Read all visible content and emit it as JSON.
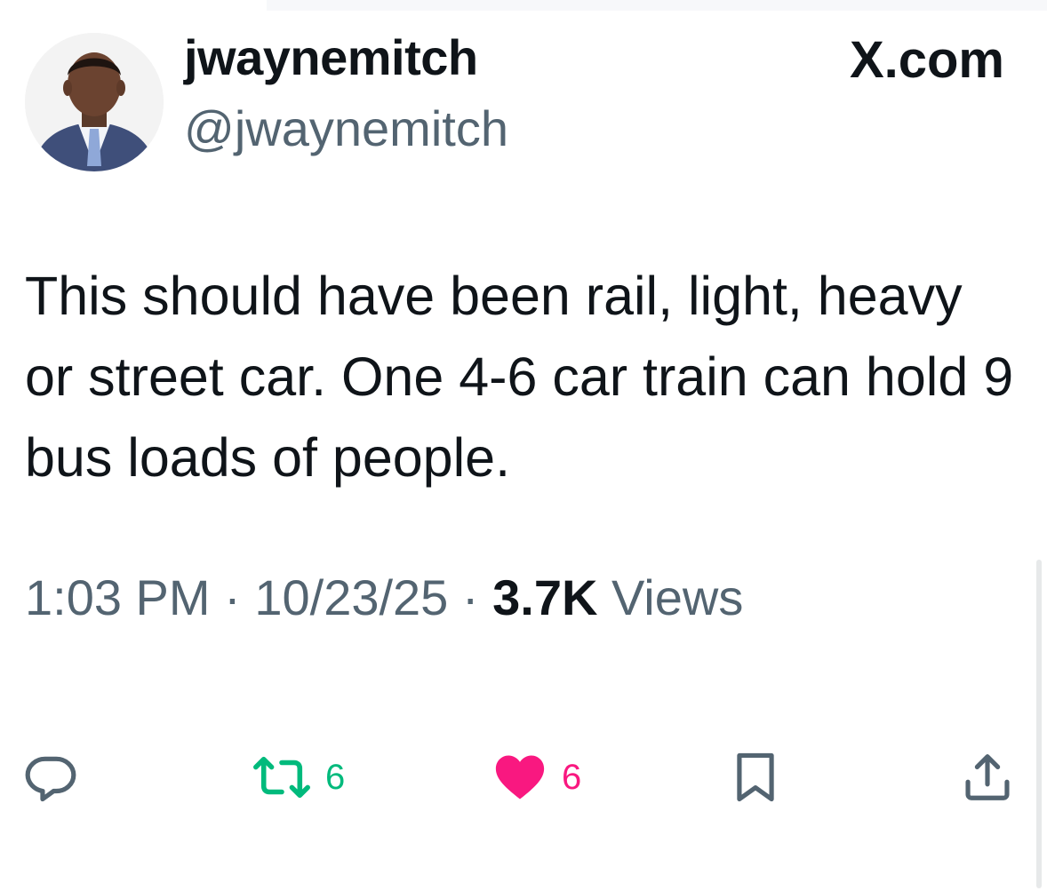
{
  "tweet": {
    "author": {
      "display_name": "jwaynemitch",
      "handle": "@jwaynemitch"
    },
    "source_brand": "X.com",
    "text": "This should have been rail, light, heavy or street car. One 4-6 car train can hold 9 bus loads of people.",
    "meta": {
      "time": "1:03 PM",
      "date": "10/23/25",
      "separator": "·",
      "views_count": "3.7K",
      "views_label": "Views"
    },
    "actions": {
      "reply_icon": "reply-icon",
      "retweet_icon": "retweet-icon",
      "retweet_count": "6",
      "like_icon": "heart-icon",
      "like_count": "6",
      "bookmark_icon": "bookmark-icon",
      "share_icon": "share-icon"
    },
    "colors": {
      "text_primary": "#0f1419",
      "text_secondary": "#536471",
      "retweet_green": "#00ba7c",
      "like_pink": "#f91880"
    }
  }
}
